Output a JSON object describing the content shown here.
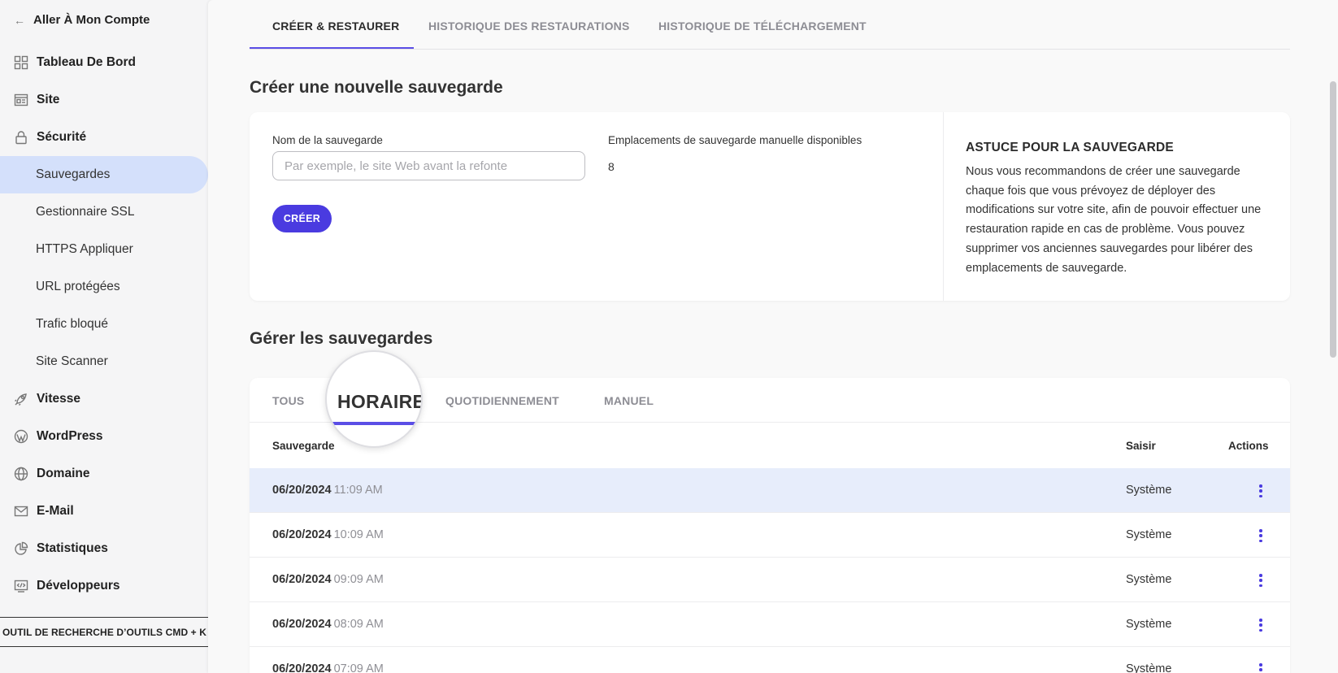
{
  "sidebar": {
    "back_label": "Aller À Mon Compte",
    "items": [
      {
        "label": "Tableau De Bord",
        "icon": "dashboard-icon"
      },
      {
        "label": "Site",
        "icon": "site-icon"
      },
      {
        "label": "Sécurité",
        "icon": "lock-icon"
      },
      {
        "label": "Sauvegardes"
      },
      {
        "label": "Gestionnaire SSL"
      },
      {
        "label": "HTTPS Appliquer"
      },
      {
        "label": "URL protégées"
      },
      {
        "label": "Trafic bloqué"
      },
      {
        "label": "Site Scanner"
      },
      {
        "label": "Vitesse",
        "icon": "rocket-icon"
      },
      {
        "label": "WordPress",
        "icon": "wordpress-icon"
      },
      {
        "label": "Domaine",
        "icon": "globe-icon"
      },
      {
        "label": "E-Mail",
        "icon": "mail-icon"
      },
      {
        "label": "Statistiques",
        "icon": "pie-chart-icon"
      },
      {
        "label": "Développeurs",
        "icon": "code-icon"
      }
    ],
    "search_tool": "OUTIL DE RECHERCHE D’OUTILS CMD + K"
  },
  "top_tabs": [
    "CRÉER & RESTAURER",
    "HISTORIQUE DES RESTAURATIONS",
    "HISTORIQUE DE TÉLÉCHARGEMENT"
  ],
  "create": {
    "title": "Créer une nouvelle sauvegarde",
    "name_label": "Nom de la sauvegarde",
    "name_placeholder": "Par exemple, le site Web avant la refonte",
    "slots_label": "Emplacements de sauvegarde manuelle disponibles",
    "slots_value": "8",
    "button": "CRÉER",
    "tip_title": "ASTUCE POUR LA SAUVEGARDE",
    "tip_text": "Nous vous recommandons de créer une sauvegarde chaque fois que vous prévoyez de déployer des modifications sur votre site, afin de pouvoir effectuer une restauration rapide en cas de problème. Vous pouvez supprimer vos anciennes sauvegardes pour libérer des emplacements de sauvegarde."
  },
  "manage": {
    "title": "Gérer les sauvegardes",
    "tabs": [
      "TOUS",
      "HORAIRE",
      "QUOTIDIENNEMENT",
      "MANUEL"
    ],
    "headers": {
      "backup": "Sauvegarde",
      "type": "Saisir",
      "actions": "Actions"
    },
    "rows": [
      {
        "date": "06/20/2024",
        "time": "11:09 AM",
        "type": "Système"
      },
      {
        "date": "06/20/2024",
        "time": "10:09 AM",
        "type": "Système"
      },
      {
        "date": "06/20/2024",
        "time": "09:09 AM",
        "type": "Système"
      },
      {
        "date": "06/20/2024",
        "time": "08:09 AM",
        "type": "Système"
      },
      {
        "date": "06/20/2024",
        "time": "07:09 AM",
        "type": "Système"
      }
    ]
  },
  "colors": {
    "accent": "#4a3be0",
    "active_nav": "#d4e0fb",
    "row_highlight": "#e7edfb"
  }
}
